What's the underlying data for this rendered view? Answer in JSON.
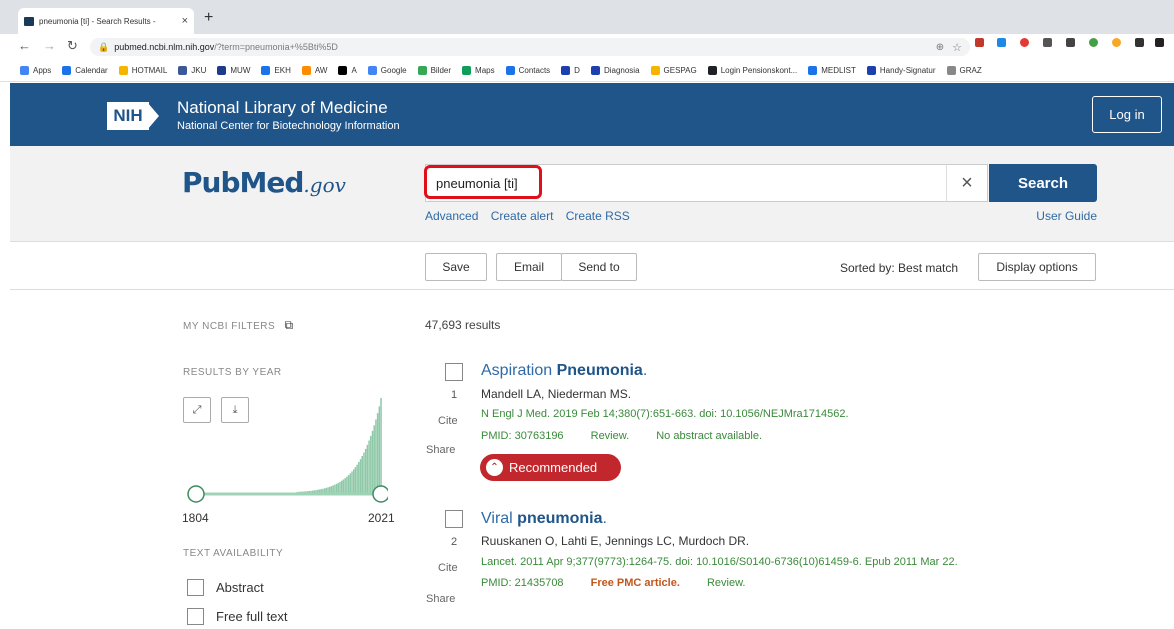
{
  "browser": {
    "tab_title": "pneumonia [ti] - Search Results -",
    "tab_close": "×",
    "new_tab": "+",
    "url_host": "pubmed.ncbi.nlm.nih.gov",
    "url_rest": "/?term=pneumonia+%5Bti%5D",
    "bookmarks": [
      "Apps",
      "Calendar",
      "HOTMAIL",
      "JKU",
      "MUW",
      "EKH",
      "AW",
      "A",
      "Google",
      "Bilder",
      "Maps",
      "Contacts",
      "D",
      "Diagnosia",
      "GESPAG",
      "Login Pensionskont...",
      "MEDLIST",
      "Handy-Signatur",
      "GRAZ"
    ],
    "bookmark_colors": [
      "#4285f4",
      "#1a73e8",
      "#f4b400",
      "#3b5998",
      "#1e3a8a",
      "#1a73e8",
      "#ff8c00",
      "#000000",
      "#4285f4",
      "#34a853",
      "#0f9d58",
      "#1a73e8",
      "#1e40af",
      "#1e40af",
      "#f4b400",
      "#202124",
      "#1a73e8",
      "#1e40af",
      "#888888"
    ]
  },
  "nih": {
    "logo_text": "NIH",
    "title": "National Library of Medicine",
    "subtitle": "National Center for Biotechnology Information",
    "login": "Log in"
  },
  "search": {
    "logo_pub": "Pub",
    "logo_med": "Med",
    "logo_gov": ".gov",
    "query": "pneumonia [ti]",
    "clear": "×",
    "button": "Search",
    "links": [
      "Advanced",
      "Create alert",
      "Create RSS"
    ],
    "user_guide": "User Guide"
  },
  "actions": {
    "save": "Save",
    "email": "Email",
    "send_to": "Send to",
    "sorted_by": "Sorted by: Best match",
    "display_options": "Display options"
  },
  "sidebar": {
    "my_filters": "MY NCBI FILTERS",
    "results_by_year": "RESULTS BY YEAR",
    "year_start": "1804",
    "year_end": "2021",
    "text_availability": "TEXT AVAILABILITY",
    "filters": [
      "Abstract",
      "Free full text"
    ]
  },
  "results": {
    "count": "47,693 results",
    "items": [
      {
        "number": "1",
        "title_plain": "Aspiration ",
        "title_bold": "Pneumonia",
        "title_end": ".",
        "authors": "Mandell LA, Niederman MS.",
        "citation": "N Engl J Med. 2019 Feb 14;380(7):651-663. doi: 10.1056/NEJMra1714562.",
        "pmid": "PMID: 30763196",
        "type": "Review.",
        "extra": "No abstract available.",
        "cite": "Cite",
        "share": "Share",
        "badge": "Recommended"
      },
      {
        "number": "2",
        "title_plain": "Viral ",
        "title_bold": "pneumonia",
        "title_end": ".",
        "authors": "Ruuskanen O, Lahti E, Jennings LC, Murdoch DR.",
        "citation": "Lancet. 2011 Apr 9;377(9773):1264-75. doi: 10.1016/S0140-6736(10)61459-6. Epub 2011 Mar 22.",
        "pmid": "PMID: 21435708",
        "free": "Free PMC article.",
        "type": "Review.",
        "cite": "Cite",
        "share": "Share"
      }
    ]
  },
  "colors": {
    "nih_blue": "#20558a",
    "link_blue": "#2f6aa6",
    "highlight_red": "#e0101a",
    "recommended_red": "#c1272d",
    "histogram_green": "#8fc9a9"
  }
}
